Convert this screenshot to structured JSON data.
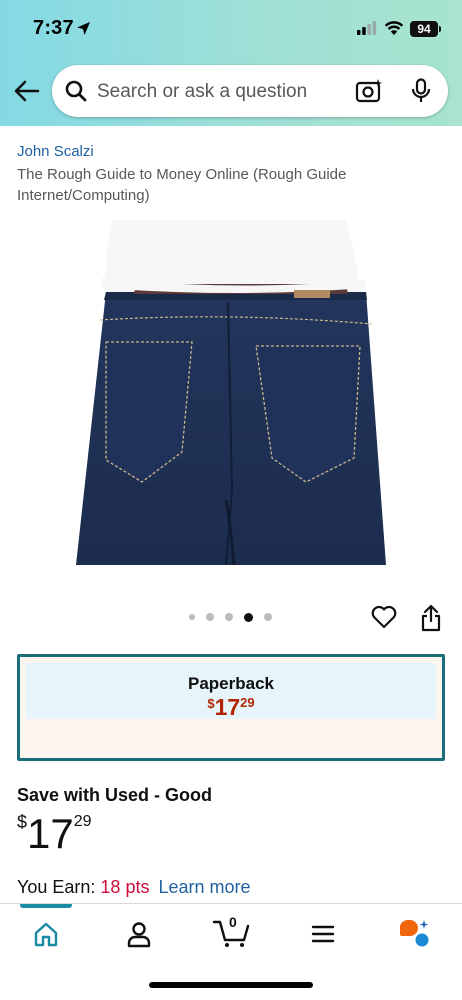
{
  "status_bar": {
    "time": "7:37",
    "battery": "94"
  },
  "search": {
    "placeholder": "Search or ask a question"
  },
  "product": {
    "author": "John Scalzi",
    "title": "The Rough Guide to Money Online (Rough Guide Internet/Computing)",
    "image_count": 5,
    "image_active_index": 3
  },
  "format": {
    "label": "Paperback",
    "price_currency": "$",
    "price_whole": "17",
    "price_fraction": "29"
  },
  "used": {
    "label": "Save with Used - Good",
    "price_currency": "$",
    "price_whole": "17",
    "price_fraction": "29"
  },
  "rewards": {
    "label": "You Earn:",
    "points": "18 pts",
    "learn_more": "Learn more"
  },
  "bottom_nav": {
    "cart_count": "0",
    "items": [
      "home-icon",
      "account-icon",
      "cart-icon",
      "menu-icon",
      "rufus-icon"
    ]
  },
  "colors": {
    "accent": "#1a6e7a",
    "price": "#b12704",
    "link": "#2162a1",
    "points": "#cc0c39"
  }
}
